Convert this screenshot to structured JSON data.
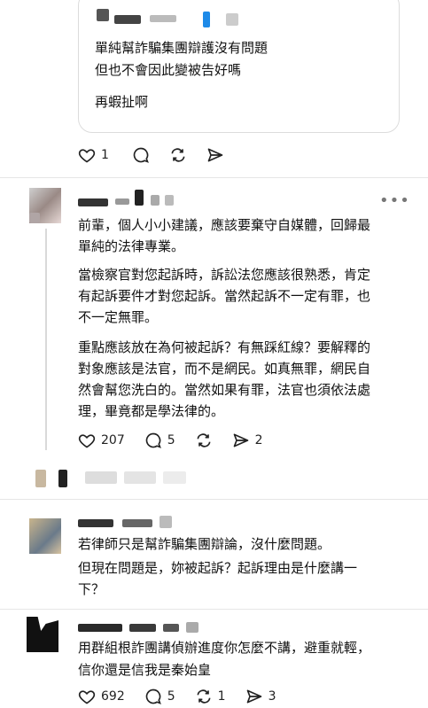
{
  "quoted_card": {
    "line1": "單純幫詐騙集團辯護沒有問題",
    "line2": "但也不會因此變被告好嗎",
    "line3": "再蝦扯啊"
  },
  "post1_actions": {
    "likes": "1"
  },
  "comment1": {
    "p1_l1": "前輩，個人小小建議，應該要棄守自媒體，回歸最",
    "p1_l2": "單純的法律專業。",
    "p2_l1": "當檢察官對您起訴時，訴訟法您應該很熟悉，肯定",
    "p2_l2": "有起訴要件才對您起訴。當然起訴不一定有罪，也",
    "p2_l3": "不一定無罪。",
    "p3_l1": "重點應該放在為何被起訴？有無踩紅線？要解釋的",
    "p3_l2": "對象應該是法官，而不是網民。如真無罪，網民自",
    "p3_l3": "然會幫您洗白的。當然如果有罪，法官也須依法處",
    "p3_l4": "理，畢竟都是學法律的。",
    "likes": "207",
    "comments": "5",
    "shares": "2"
  },
  "comment2": {
    "l1": "若律師只是幫詐騙集團辯論，沒什麼問題。",
    "l2": "但現在問題是，妳被起訴？起訴理由是什麼講一",
    "l3": "下？"
  },
  "comment3": {
    "l1": "用群組根詐團講偵辦進度你怎麼不講，避重就輕，",
    "l2": "信你還是信我是秦始皇",
    "likes": "692",
    "comments": "5",
    "reposts": "1",
    "shares": "3"
  },
  "colors": {
    "text": "#111111",
    "icon": "#222222",
    "border": "#dcdcdc",
    "accent_blur": "#1d8ae8"
  },
  "icons": [
    "heart-icon",
    "comment-icon",
    "repost-icon",
    "share-icon",
    "more-icon"
  ]
}
